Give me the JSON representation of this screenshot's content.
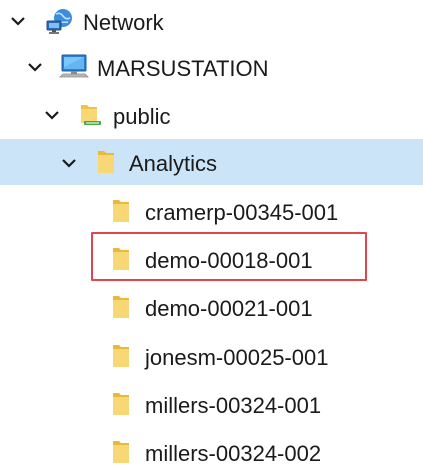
{
  "tree": {
    "network": {
      "label": "Network",
      "icon": "network-globe-icon",
      "expanded": true
    },
    "computer": {
      "label": "MARSUSTATION",
      "icon": "computer-icon",
      "expanded": true
    },
    "share": {
      "label": "public",
      "icon": "shared-folder-icon",
      "expanded": true
    },
    "analytics": {
      "label": "Analytics",
      "icon": "folder-icon",
      "expanded": true,
      "selected": true
    },
    "children": [
      {
        "label": "cramerp-00345-001",
        "icon": "folder-icon"
      },
      {
        "label": "demo-00018-001",
        "icon": "folder-icon",
        "highlighted": true
      },
      {
        "label": "demo-00021-001",
        "icon": "folder-icon"
      },
      {
        "label": "jonesm-00025-001",
        "icon": "folder-icon"
      },
      {
        "label": "millers-00324-001",
        "icon": "folder-icon"
      },
      {
        "label": "millers-00324-002",
        "icon": "folder-icon"
      }
    ]
  },
  "colors": {
    "selection_background": "#cce4f7",
    "highlight_border": "#e0474c",
    "folder_yellow": "#f8d775"
  }
}
